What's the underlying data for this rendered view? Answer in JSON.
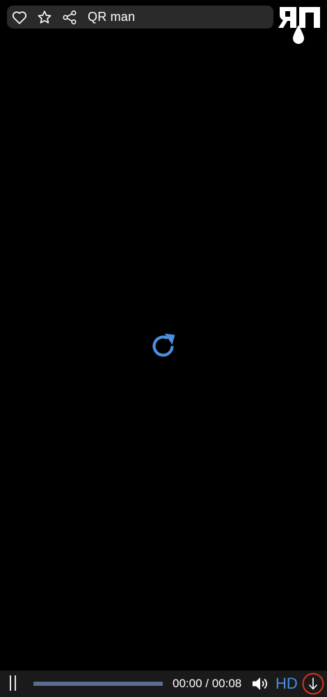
{
  "header": {
    "title": "QR man",
    "icons": [
      "heart-icon",
      "star-icon",
      "share-icon"
    ]
  },
  "logo": {
    "text": "ЯП",
    "icon": "logo-drop"
  },
  "center": {
    "icon": "reload-icon",
    "color": "#4a8fe0"
  },
  "controls": {
    "pause_icon": "pause-icon",
    "time": "00:00 / 00:08",
    "progress": 0,
    "volume_icon": "volume-icon",
    "hd_label": "HD",
    "download_icon": "download-icon",
    "accent_color": "#4a8fe0",
    "highlight_color": "#e0301e"
  }
}
